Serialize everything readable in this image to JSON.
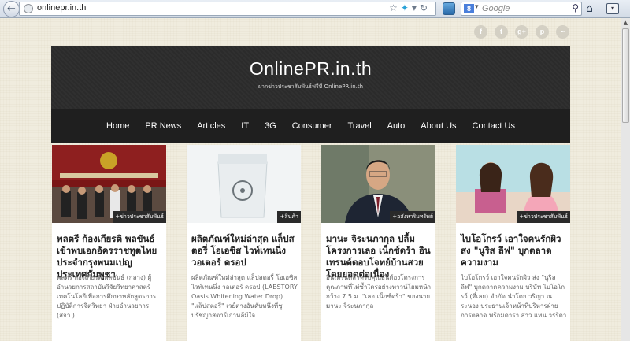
{
  "browser": {
    "url": "onlinepr.in.th",
    "search_engine_badge": "8",
    "search_placeholder": "Google"
  },
  "social_icons": [
    {
      "name": "facebook-icon",
      "glyph": "f"
    },
    {
      "name": "twitter-icon",
      "glyph": "t"
    },
    {
      "name": "googleplus-icon",
      "glyph": "g+"
    },
    {
      "name": "pinterest-icon",
      "glyph": "p"
    },
    {
      "name": "rss-icon",
      "glyph": "~"
    }
  ],
  "header": {
    "title": "OnlinePR.in.th",
    "subtitle": "ฝากข่าวประชาสัมพันธ์ฟรีที่ OnlinePR.in.th"
  },
  "nav": {
    "items": [
      "Home",
      "PR News",
      "Articles",
      "IT",
      "3G",
      "Consumer",
      "Travel",
      "Auto",
      "About Us",
      "Contact Us"
    ]
  },
  "cards": [
    {
      "category": "+ข่าวประชาสัมพันธ์",
      "title": "พลตรี ก้องเกียรติ พลขันธ์ เข้าพบเอกอัครราชทูตไทยประจำกรุงพนมเปญ ประเทศกัมพูชา",
      "excerpt": "พลตรี ก้องเกียรติ พลขันธ์ (กลาง) ผู้อำนวยการสถาบันวิจัยวิทยาศาสตร์เทคโนโลยีเพื่อการศึกษาหลักสูตรการปฏิบัติการจิตวิทยา ฝ่ายอำนวยการ (สจว.)"
    },
    {
      "category": "+สินค้า",
      "title": "ผลิตภัณฑ์ใหม่ล่าสุด แล็ปสตอรี่ โอเอซิส ไวท์เทนนิ่ง วอเตอร์ ดรอป",
      "excerpt": "ผลิตภัณฑ์ใหม่ล่าสุด แล็ปสตอรี่ โอเอซิส ไวท์เทนนิ่ง วอเตอร์ ดรอป (LABSTORY Oasis Whitening Water Drop) \"แล็ปสตอรี่\" เวย์ต่างอันดับหนึ่งที่ชูปรัชญาสตาร์เกาหลีมีใจ"
    },
    {
      "category": "+อสังหาริมทรัพย์",
      "title": "มานะ จิระนภากุล ปลื้มโครงการเลอ เน็กซ์ดร้า อินเทรนด์ตอบโจทย์บ้านสวยโดยยอดต่อเนื่อง",
      "excerpt": "อินเทรนด์สำหรับคุณอันต้องโครงการคุณภาพที่ไม่ซ้ำใครอย่างทาวน์โฮมหน้ากว้าง 7.5 ม. \"เลอ เน็กซ์ดร้า\" ของนายมานะ จิระนภากุล"
    },
    {
      "category": "+ข่าวประชาสัมพันธ์",
      "title": "ไบโอโกรว์ เอาใจคนรักผิวสง \"นูริส ลีฟ\" บุกตลาดความงาม",
      "excerpt": "ไบโอโกรว์ เอาใจคนรักผิว ส่ง \"นูริส ลีฟ\" บุกตลาดความงาม บริษัท ไบโอโกรว์ (ที่เลย) จำกัด นำโดย วริญา ณ ระนอง ประธานเจ้าหน้าที่บริหารฝ่ายการตลาด พร้อมดารา สาว แทน วรรีดา"
    }
  ]
}
